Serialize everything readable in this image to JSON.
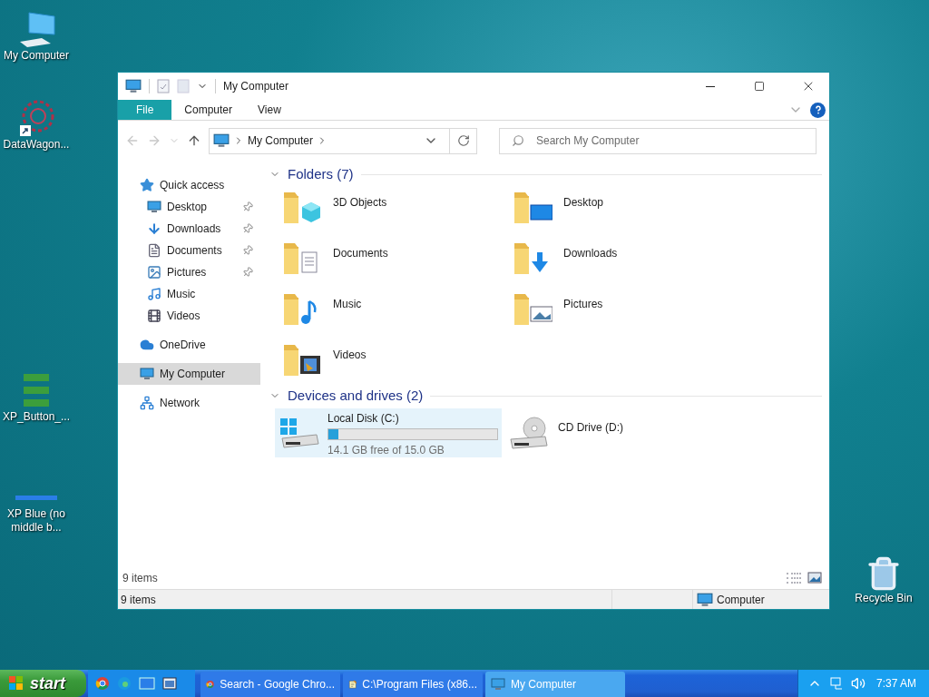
{
  "desktop_icons": [
    {
      "label": "My Computer",
      "kind": "computer"
    },
    {
      "label": "DataWagon...",
      "kind": "app"
    },
    {
      "label": "XP_Button_...",
      "kind": "buttons"
    },
    {
      "label": "XP Blue (no middle b...",
      "kind": "theme"
    },
    {
      "label": "Recycle Bin",
      "kind": "recycle"
    }
  ],
  "window": {
    "title": "My Computer",
    "ribbon_tabs": [
      {
        "label": "File",
        "selected": true
      },
      {
        "label": "Computer",
        "selected": false
      },
      {
        "label": "View",
        "selected": false
      }
    ],
    "address": "My Computer",
    "search": {
      "placeholder": "Search My Computer"
    },
    "sidebar": {
      "items": [
        {
          "label": "Quick access",
          "kind": "star",
          "selected": false,
          "children": [
            {
              "label": "Desktop",
              "kind": "desktop",
              "pinned": true,
              "selected": false
            },
            {
              "label": "Downloads",
              "kind": "downloads",
              "pinned": true,
              "selected": false
            },
            {
              "label": "Documents",
              "kind": "documents",
              "pinned": true,
              "selected": false
            },
            {
              "label": "Pictures",
              "kind": "pictures",
              "pinned": true,
              "selected": false
            },
            {
              "label": "Music",
              "kind": "music",
              "pinned": false,
              "selected": false
            },
            {
              "label": "Videos",
              "kind": "videos",
              "pinned": false,
              "selected": false
            }
          ]
        },
        {
          "label": "OneDrive",
          "kind": "cloud",
          "selected": false
        },
        {
          "label": "My Computer",
          "kind": "computer",
          "selected": true
        },
        {
          "label": "Network",
          "kind": "network",
          "selected": false
        }
      ]
    },
    "folders": {
      "title": "Folders (7)",
      "items": [
        {
          "name": "3D Objects",
          "kind": "objects3d"
        },
        {
          "name": "Desktop",
          "kind": "desktop"
        },
        {
          "name": "Documents",
          "kind": "documents"
        },
        {
          "name": "Downloads",
          "kind": "downloads"
        },
        {
          "name": "Music",
          "kind": "music"
        },
        {
          "name": "Pictures",
          "kind": "pictures"
        },
        {
          "name": "Videos",
          "kind": "videos"
        }
      ]
    },
    "devices": {
      "title": "Devices and drives (2)",
      "items": [
        {
          "name": "Local Disk (C:)",
          "kind": "disk",
          "selected": true,
          "level": 0.06,
          "free": "14.1 GB free of 15.0 GB"
        },
        {
          "name": "CD Drive (D:)",
          "kind": "cd",
          "selected": false
        }
      ]
    },
    "footer_count": "9 items",
    "status_bar": {
      "count": "9 items",
      "location": "Computer"
    }
  },
  "taskbar": {
    "start": "start",
    "tasks": [
      {
        "label": "Search - Google Chro...",
        "kind": "browser",
        "selected": false
      },
      {
        "label": "C:\\Program Files (x86...",
        "kind": "notepad",
        "selected": false
      },
      {
        "label": "My Computer",
        "kind": "computer",
        "selected": true
      }
    ],
    "time": "7:37 AM"
  }
}
